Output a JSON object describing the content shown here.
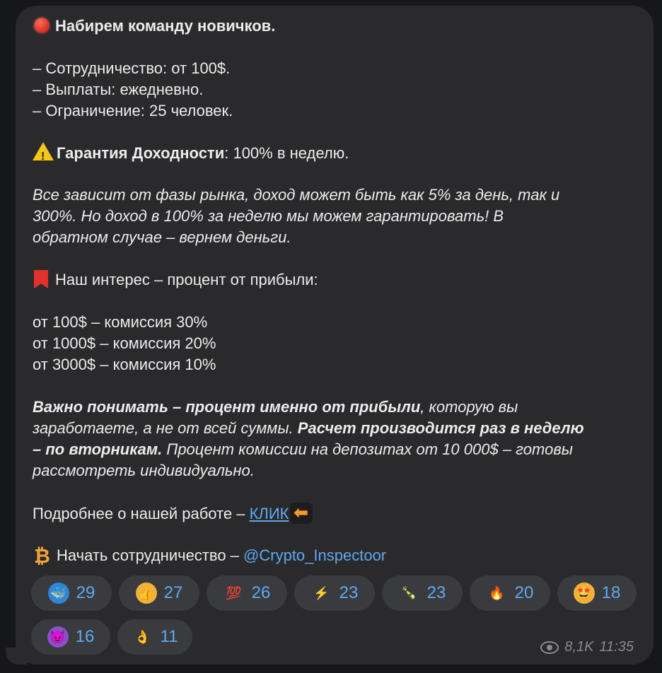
{
  "message": {
    "title": "Набирем команду новичков.",
    "line_coop": "– Сотрудничество: от 100$.",
    "line_pay": "– Выплаты: ежедневно.",
    "line_limit": "– Ограничение: 25 человек.",
    "guarantee_label": "Гарантия Доходности",
    "guarantee_value": ": 100% в неделю.",
    "italic_1": "Все зависит от фазы рынка, доход может быть как 5% за день, так и",
    "italic_2": "300%. Но доход в 100% за неделю мы можем гарантировать! В",
    "italic_3": "обратном случае – вернем деньги.",
    "interest": "Наш интерес – процент от прибыли:",
    "fee_1": "от 100$ – комиссия 30%",
    "fee_2": "от 1000$ – комиссия 20%",
    "fee_3": "от 3000$ – комиссия 10%",
    "important_b": "Важно понимать – процент именно от прибыли",
    "important_i": ", которую вы",
    "earn_i": "заработаете, а не от всей суммы. ",
    "calc_b": "Расчет производится раз в неделю",
    "tuesday_b": "– по вторникам.",
    "tuesday_i": " Процент комиссии на депозитах от 10 000$ – готовы",
    "individual_i": "рассмотреть индивидуально.",
    "more_text": "Подробнее о нашей работе – ",
    "more_link": "КЛИК",
    "start_text": "Начать сотрудничество – ",
    "start_link": "@Crypto_Inspectoor"
  },
  "reactions": [
    {
      "icon": "🐳",
      "count": "29"
    },
    {
      "icon": "👍",
      "count": "27"
    },
    {
      "icon": "💯",
      "count": "26"
    },
    {
      "icon": "⚡",
      "count": "23"
    },
    {
      "icon": "🍾",
      "count": "23"
    },
    {
      "icon": "🔥",
      "count": "20"
    },
    {
      "icon": "🤩",
      "count": "18"
    },
    {
      "icon": "😈",
      "count": "16"
    },
    {
      "icon": "👌",
      "count": "11"
    }
  ],
  "meta": {
    "views": "8,1K",
    "time": "11:35"
  }
}
